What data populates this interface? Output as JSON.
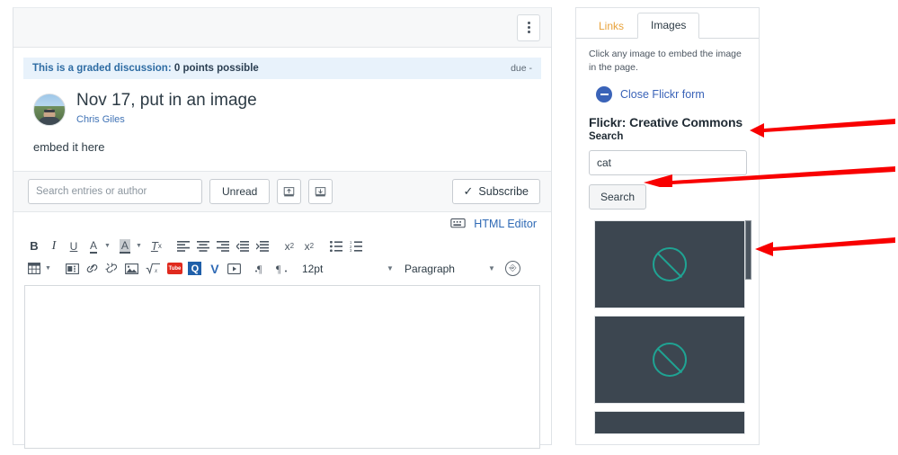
{
  "discussion": {
    "kebab_menu": "⋮",
    "graded_banner": {
      "prefix": "This is a graded discussion:",
      "points": "0 points possible",
      "due": "due -"
    },
    "post": {
      "title": "Nov 17, put in an image",
      "author": "Chris Giles",
      "body": "embed it here"
    },
    "toolbar": {
      "search_placeholder": "Search entries or author",
      "search_value": "",
      "unread_label": "Unread",
      "collapse_icon": "collapse-threads-icon",
      "expand_icon": "expand-threads-icon",
      "subscribe_label": "Subscribe",
      "subscribe_check": "✓"
    },
    "html_editor": {
      "icon": "keyboard-icon",
      "label": "HTML Editor"
    }
  },
  "rce": {
    "row1": [
      {
        "name": "bold",
        "glyph": "B",
        "style": "bold"
      },
      {
        "name": "italic",
        "glyph": "I",
        "style": "italic"
      },
      {
        "name": "underline",
        "glyph": "U",
        "style": "underline"
      },
      {
        "name": "text-color",
        "glyph": "A",
        "style": "underline-color"
      },
      {
        "name": "text-color-caret",
        "glyph": "▼",
        "style": "caret"
      },
      {
        "name": "background-color",
        "glyph": "A",
        "style": "highlight"
      },
      {
        "name": "background-color-caret",
        "glyph": "▼",
        "style": "caret"
      },
      {
        "name": "clear-formatting",
        "glyph": "T",
        "style": "clear"
      },
      {
        "name": "align-left",
        "glyph": "≡",
        "style": "align-left"
      },
      {
        "name": "align-center",
        "glyph": "≡",
        "style": "align-center"
      },
      {
        "name": "align-right",
        "glyph": "≡",
        "style": "align-right"
      },
      {
        "name": "outdent",
        "glyph": "≡",
        "style": "outdent"
      },
      {
        "name": "indent",
        "glyph": "≡",
        "style": "indent"
      },
      {
        "name": "superscript",
        "glyph": "x²",
        "style": "plain"
      },
      {
        "name": "subscript",
        "glyph": "x₂",
        "style": "plain"
      },
      {
        "name": "bulleted-list",
        "glyph": "☰",
        "style": "bullet-list"
      },
      {
        "name": "numbered-list",
        "glyph": "☰",
        "style": "number-list"
      }
    ],
    "row2": [
      {
        "name": "table",
        "glyph": "▦"
      },
      {
        "name": "table-caret",
        "glyph": "▼"
      },
      {
        "name": "media",
        "glyph": "▣"
      },
      {
        "name": "link",
        "glyph": "🔗"
      },
      {
        "name": "unlink",
        "glyph": "✂"
      },
      {
        "name": "image",
        "glyph": "🖼"
      },
      {
        "name": "math-equation",
        "glyph": "√x"
      },
      {
        "name": "youtube",
        "glyph": "Tube"
      },
      {
        "name": "office-365",
        "glyph": "Q"
      },
      {
        "name": "vimeo",
        "glyph": "V"
      },
      {
        "name": "embed-video",
        "glyph": "▷"
      },
      {
        "name": "ltr-direction",
        "glyph": "¶"
      },
      {
        "name": "rtl-direction",
        "glyph": "¶"
      }
    ],
    "font_size": "12pt",
    "paragraph_format": "Paragraph",
    "accessibility_checker": "accessibility-icon"
  },
  "sidebar": {
    "tabs": [
      {
        "label": "Links",
        "active": false
      },
      {
        "label": "Images",
        "active": true
      }
    ],
    "help_text": "Click any image to embed the image in the page.",
    "close_flickr_label": "Close Flickr form",
    "flickr_title": "Flickr: Creative Commons",
    "search_label": "Search",
    "search_value": "cat",
    "search_placeholder": "",
    "search_button": "Search",
    "results": [
      {
        "name": "image-result-1",
        "state": "broken"
      },
      {
        "name": "image-result-2",
        "state": "broken"
      },
      {
        "name": "image-result-3",
        "state": "broken"
      }
    ]
  },
  "annotations": {
    "color": "#f80000",
    "arrows": [
      {
        "name": "arrow-flickr-title",
        "points_to": "Flickr: Creative Commons"
      },
      {
        "name": "arrow-search-input",
        "points_to": "cat search field"
      },
      {
        "name": "arrow-scrollbar",
        "points_to": "results scrollbar"
      }
    ]
  }
}
